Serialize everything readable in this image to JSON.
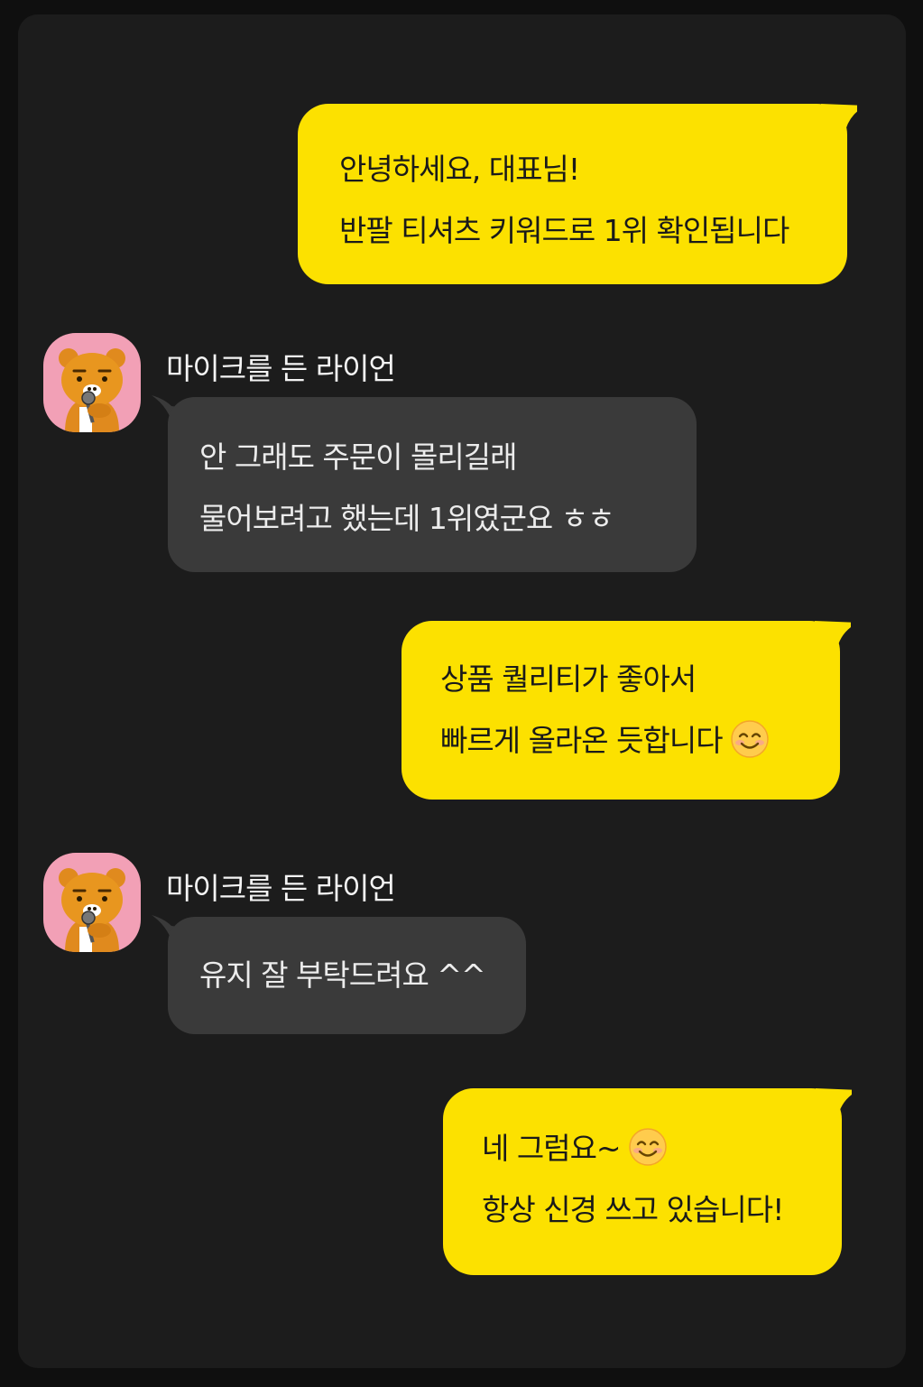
{
  "messages": [
    {
      "from": "me",
      "lines": [
        "안녕하세요, 대표님!",
        "반팔 티셔츠 키워드로 1위 확인됩니다"
      ]
    },
    {
      "from": "other",
      "sender": "마이크를 든 라이언",
      "avatar_icon": "ryan-character-holding-microphone",
      "lines": [
        "안 그래도 주문이 몰리길래",
        "물어보려고 했는데 1위였군요 ㅎㅎ"
      ]
    },
    {
      "from": "me",
      "lines": [
        "상품 퀄리티가 좋아서",
        "빠르게 올라온 듯합니다"
      ],
      "trailing_icon": "smiling-face-emoji"
    },
    {
      "from": "other",
      "sender": "마이크를 든 라이언",
      "avatar_icon": "ryan-character-holding-microphone",
      "lines": [
        "유지 잘 부탁드려요 ^^"
      ]
    },
    {
      "from": "me",
      "lines": [
        "네 그럼요~",
        "항상 신경 쓰고 있습니다!"
      ],
      "inline_icon": "smiling-face-emoji"
    }
  ],
  "colors": {
    "background": "#0f0f0f",
    "panel": "#1c1c1c",
    "my_bubble": "#fce100",
    "their_bubble": "#3a3a3a",
    "avatar_bg": "#f2a0b6"
  }
}
